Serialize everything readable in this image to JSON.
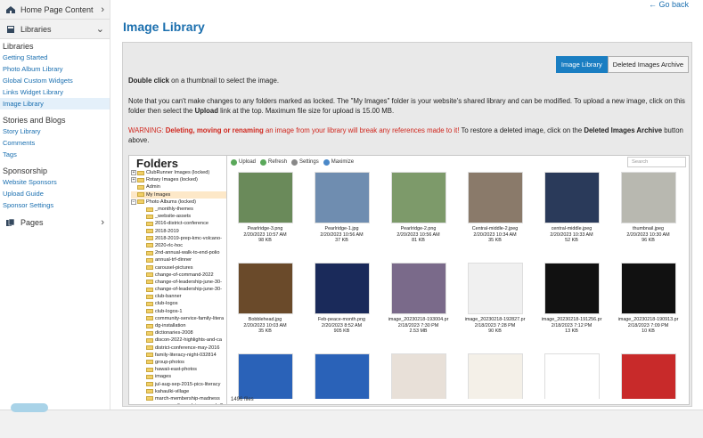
{
  "sidebar": {
    "home": "Home Page Content",
    "libraries": "Libraries",
    "libraries_head": "Libraries",
    "lib_links": [
      "Getting Started",
      "Photo Album Library",
      "Global Custom Widgets",
      "Links Widget Library",
      "Image Library"
    ],
    "stories_head": "Stories and Blogs",
    "story_links": [
      "Story Library",
      "Comments",
      "Tags"
    ],
    "sponsorship_head": "Sponsorship",
    "sponsor_links": [
      "Website Sponsors",
      "Upload Guide",
      "Sponsor Settings"
    ],
    "pages": "Pages"
  },
  "main": {
    "go_back": "← Go back",
    "title": "Image Library",
    "tab_library": "Image Library",
    "tab_archive": "Deleted Images Archive",
    "p1_bold": "Double click",
    "p1_rest": " on a thumbnail to select the image.",
    "p2a": "Note that you can't make changes to any folders marked as locked. The \"My Images\" folder is your website's shared library and can be modified. To upload a new image, click on this folder then select the ",
    "p2_bold": "Upload",
    "p2b": " link at the top. Maximum file size for upload is 15.00 MB.",
    "p3_warn": "WARNING: ",
    "p3_bold": "Deleting, moving or renaming",
    "p3_red": " an image from your library will break any references made to it!",
    "p3a": " To restore a deleted image, click on the ",
    "p3_bold2": "Deleted Images Archive",
    "p3b": " button above."
  },
  "browser": {
    "folders_title": "Folders",
    "toolbar": {
      "upload": "Upload",
      "refresh": "Refresh",
      "settings": "Settings",
      "maximize": "Maximize"
    },
    "search_placeholder": "Search",
    "file_count": "1496 files",
    "top_folders": [
      "ClubRunner Images (locked)",
      "Rotary Images (locked)",
      "Admin",
      "My Images",
      "Photo Albums (locked)"
    ],
    "sub_folders": [
      "_monthly-themes",
      "_website-assets",
      "2016-district-conference",
      "2018-2019",
      "2018-2019-prep-kmc-volcano-",
      "2020-rlc-hoc",
      "2nd-annual-walk-to-end-polio",
      "annual-trf-dinner",
      "carousel-pictures",
      "change-of-command-2022",
      "change-of-leadership-june-30-",
      "change-of-leadership-june-30-",
      "club-banner",
      "club-logos",
      "club-logos-1",
      "community-service-family-litera",
      "dg-installation",
      "dictionaries-2008",
      "discon-2022-highlights-and-ca",
      "district-conference-may-2016",
      "family-literacy-night-032814",
      "group-photos",
      "hawaii-east-photos",
      "images",
      "jul-aug-sep-2015-pics-literacy",
      "kahaulki-village",
      "march-membership-madness",
      "mayor-mufi-proclaims-march-2"
    ],
    "images": [
      {
        "name": "Pearlridge-3.png",
        "date": "2/20/2023 10:57 AM",
        "size": "98 KB",
        "color": "#6a8a5a"
      },
      {
        "name": "Pearlridge-1.jpg",
        "date": "2/20/2023 10:56 AM",
        "size": "37 KB",
        "color": "#6f8db0"
      },
      {
        "name": "Pearlridge-2.png",
        "date": "2/20/2023 10:56 AM",
        "size": "81 KB",
        "color": "#7d9a6a"
      },
      {
        "name": "Central-middle-2.jpeg",
        "date": "2/20/2023 10:34 AM",
        "size": "35 KB",
        "color": "#8a7a6a"
      },
      {
        "name": "central-middle.jpeg",
        "date": "2/20/2023 10:33 AM",
        "size": "52 KB",
        "color": "#2a3a5a"
      },
      {
        "name": "thumbnail.jpeg",
        "date": "2/20/2023 10:30 AM",
        "size": "96 KB",
        "color": "#b8b8b0"
      },
      {
        "name": "Bobblehead.jpg",
        "date": "2/20/2023 10:03 AM",
        "size": "35 KB",
        "color": "#6a4a2a"
      },
      {
        "name": "Feb-peace-month.png",
        "date": "2/20/2023 8:52 AM",
        "size": "905 KB",
        "color": "#1a2a5a"
      },
      {
        "name": "image_20230218-193004.pr",
        "date": "2/18/2023 7:30 PM",
        "size": "2.53 MB",
        "color": "#7a6a8a"
      },
      {
        "name": "image_20230218-192827.pr",
        "date": "2/18/2023 7:28 PM",
        "size": "90 KB",
        "color": "#f0f0f0"
      },
      {
        "name": "image_20230218-191256.pr",
        "date": "2/18/2023 7:12 PM",
        "size": "13 KB",
        "color": "#111111"
      },
      {
        "name": "image_20230218-190913.pr",
        "date": "2/18/2023 7:09 PM",
        "size": "10 KB",
        "color": "#111111"
      },
      {
        "name": "",
        "date": "",
        "size": "",
        "color": "#2a62b8"
      },
      {
        "name": "",
        "date": "",
        "size": "",
        "color": "#2a62b8"
      },
      {
        "name": "",
        "date": "",
        "size": "",
        "color": "#e8e0d8"
      },
      {
        "name": "",
        "date": "",
        "size": "",
        "color": "#f4f0e8"
      },
      {
        "name": "",
        "date": "",
        "size": "",
        "color": "#ffffff"
      },
      {
        "name": "",
        "date": "",
        "size": "",
        "color": "#c82a2a"
      }
    ]
  }
}
